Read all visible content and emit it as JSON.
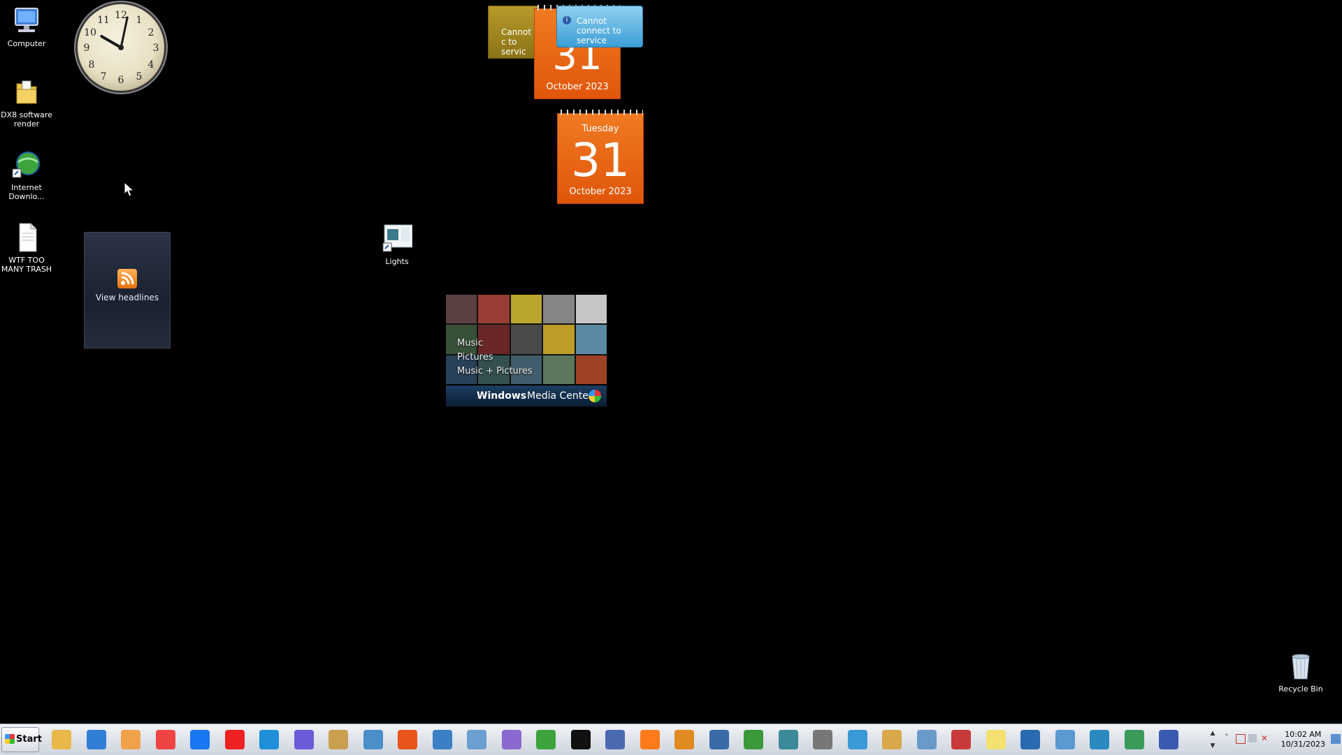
{
  "desktop_icons": [
    {
      "label": "Computer"
    },
    {
      "label": "DX8 software render"
    },
    {
      "label": "Internet Downlo..."
    },
    {
      "label": "WTF TOO MANY TRASH"
    }
  ],
  "lights_icon": {
    "label": "Lights"
  },
  "recycle_bin": {
    "label": "Recycle Bin"
  },
  "clock_gadget": {
    "numbers": [
      "12",
      "1",
      "2",
      "3",
      "4",
      "5",
      "6",
      "7",
      "8",
      "9",
      "10",
      "11"
    ]
  },
  "calendar_small": {
    "day_number": "31",
    "month_year": "October 2023"
  },
  "calendar_large": {
    "weekday": "Tuesday",
    "day_number": "31",
    "month_year": "October 2023"
  },
  "weather_gadget": {
    "message": "Cannot connect to service",
    "partial_message": "Cannot c to servic"
  },
  "feed_gadget": {
    "label": "View headlines"
  },
  "wmc_gadget": {
    "menu": [
      "Music",
      "Pictures",
      "Music + Pictures"
    ],
    "title_bold": "Windows",
    "title_rest": " Media Center"
  },
  "taskbar": {
    "start_label": "Start",
    "pinned": [
      "file-explorer",
      "internet-explorer",
      "media-player",
      "chrome",
      "facebook",
      "youtube",
      "edge",
      "teams-copilot",
      "archive-manager",
      "control-panel",
      "office",
      "remote-desktop",
      "task-manager",
      "paint-tool",
      "internet-download-manager",
      "7zip",
      "photo-viewer",
      "firefox",
      "search-tool",
      "scanner",
      "charts-tool",
      "screen-tool",
      "printer",
      "paper-plane",
      "paint",
      "calculator",
      "snipping-tool",
      "sticky-notes",
      "display-settings",
      "document-tool",
      "network-tool",
      "recycle-tool",
      "monitor-tool"
    ],
    "time": "10:02 AM",
    "date": "10/31/2023"
  },
  "colors": {
    "desktop": "#000000",
    "calendar": "#e8651a",
    "taskbar": "#dfe3ea"
  }
}
